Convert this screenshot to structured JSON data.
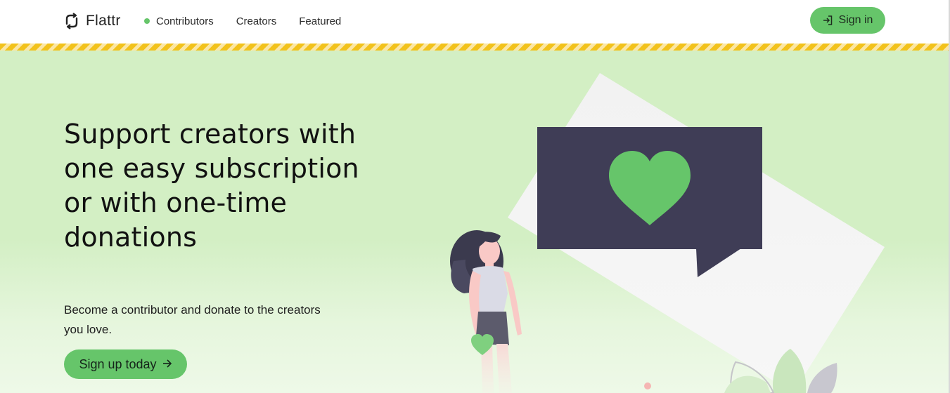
{
  "header": {
    "logo_text": "Flattr",
    "nav": [
      {
        "label": "Contributors"
      },
      {
        "label": "Creators"
      },
      {
        "label": "Featured"
      }
    ],
    "signin_label": "Sign in"
  },
  "hero": {
    "title": "Support creators with one easy subscription or with one-time donations",
    "subtitle": "Become a contributor and donate to the creators you love.",
    "signup_label": "Sign up today"
  },
  "colors": {
    "accent_green": "#66c56a",
    "hero_background": "#d3efc4",
    "stripe_yellow": "#f2c21b",
    "speech_bubble": "#3f3d56"
  },
  "icons": {
    "logo": "flattr-logo-icon",
    "signin": "sign-in-icon",
    "signup": "arrow-right-icon",
    "active_nav": "active-dot-icon"
  }
}
